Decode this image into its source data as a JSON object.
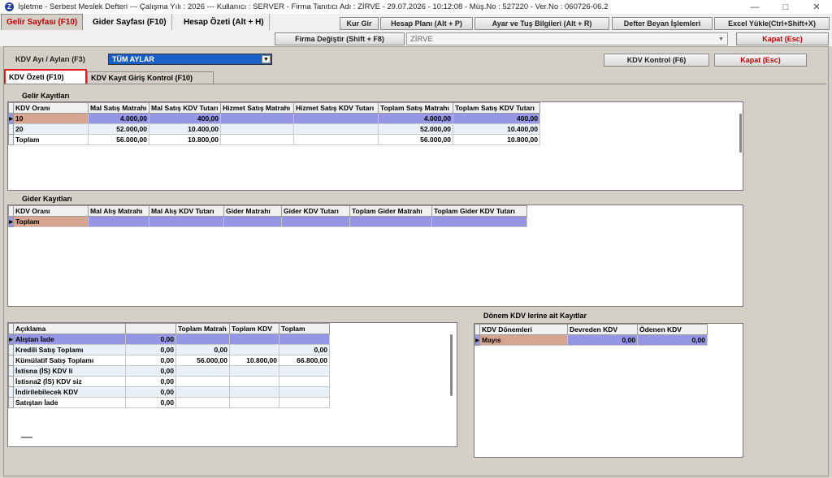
{
  "titlebar": {
    "title": "İşletme - Serbest Meslek Defteri  ---  Çalışma Yılı : 2026  ---  Kullanıcı : SERVER - Firma Tanıtıcı Adı : ZİRVE - 29.07.2026 - 10:12:08 - Müş.No : 527220 - Ver.No : 060726-06.2",
    "minimize": "—",
    "maximize": "□",
    "close": "✕"
  },
  "menubar": {
    "tabs": [
      "Gelir Sayfası (F10)",
      "Gider Sayfası (F10)",
      "Hesap Özeti (Alt + H)"
    ],
    "buttons": {
      "kur_gir": "Kur Gir",
      "hesap_plani": "Hesap Planı (Alt + P)",
      "ayar_tus": "Ayar ve Tuş Bilgileri (Alt + R)",
      "defter_beyan": "Defter Beyan İşlemleri",
      "excel_yukle": "Excel Yükle(Ctrl+Shift+X)",
      "firma_degistir": "Firma Değiştir (Shift + F8)",
      "kapat": "Kapat (Esc)"
    },
    "firma_value": "ZİRVE"
  },
  "kdv": {
    "month_label": "KDV Ayı / Ayları (F3)",
    "month_value": "TÜM AYLAR",
    "kdv_kontrol": "KDV Kontrol (F6)",
    "kapat": "Kapat (Esc)",
    "subtabs": [
      "KDV Özeti (F10)",
      "KDV Kayıt Giriş Kontrol  (F10)"
    ]
  },
  "gelir": {
    "title": "Gelir Kayıtları",
    "columns": [
      "KDV Oranı",
      "Mal Satış Matrahı",
      "Mal Satış KDV Tutarı",
      "Hizmet Satış Matrahı",
      "Hizmet Satış KDV Tutarı",
      "Toplam Satış Matrahı",
      "Toplam Satış KDV Tutarı"
    ],
    "rows": [
      [
        "10",
        "4.000,00",
        "400,00",
        "",
        "",
        "4.000,00",
        "400,00"
      ],
      [
        "20",
        "52.000,00",
        "10.400,00",
        "",
        "",
        "52.000,00",
        "10.400,00"
      ],
      [
        "Toplam",
        "56.000,00",
        "10.800,00",
        "",
        "",
        "56.000,00",
        "10.800,00"
      ]
    ]
  },
  "gider": {
    "title": "Gider Kayıtları",
    "columns": [
      "KDV Oranı",
      "Mal Alış Matrahı",
      "Mal Alış KDV Tutarı",
      "Gider Matrahı",
      "Gider KDV Tutarı",
      "Toplam Gider Matrahı",
      "Toplam Gider KDV Tutarı"
    ],
    "rows": [
      [
        "Toplam",
        "",
        "",
        "",
        "",
        "",
        ""
      ]
    ]
  },
  "ozet": {
    "columns": [
      "Açıklama",
      "",
      "Toplam Matrah",
      "Toplam KDV",
      "Toplam"
    ],
    "rows": [
      [
        "Alıştan İade",
        "0,00",
        "",
        "",
        ""
      ],
      [
        "Kredili Satış Toplamı",
        "0,00",
        "0,00",
        "",
        "0,00"
      ],
      [
        "Kümülatif Satış Toplamı",
        "0,00",
        "56.000,00",
        "10.800,00",
        "66.800,00"
      ],
      [
        "İstisna (İS) KDV li",
        "0,00",
        "",
        "",
        ""
      ],
      [
        "İstisna2 (İS) KDV siz",
        "0,00",
        "",
        "",
        ""
      ],
      [
        "İndirilebilecek KDV",
        "0,00",
        "",
        "",
        ""
      ],
      [
        "Satıştan İade",
        "0,00",
        "",
        "",
        ""
      ]
    ]
  },
  "donem": {
    "title": "Dönem KDV lerine ait Kayıtlar",
    "columns": [
      "KDV Dönemleri",
      "Devreden KDV",
      "Ödenen KDV"
    ],
    "rows": [
      [
        "Mayıs",
        "0,00",
        "0,00"
      ]
    ]
  }
}
